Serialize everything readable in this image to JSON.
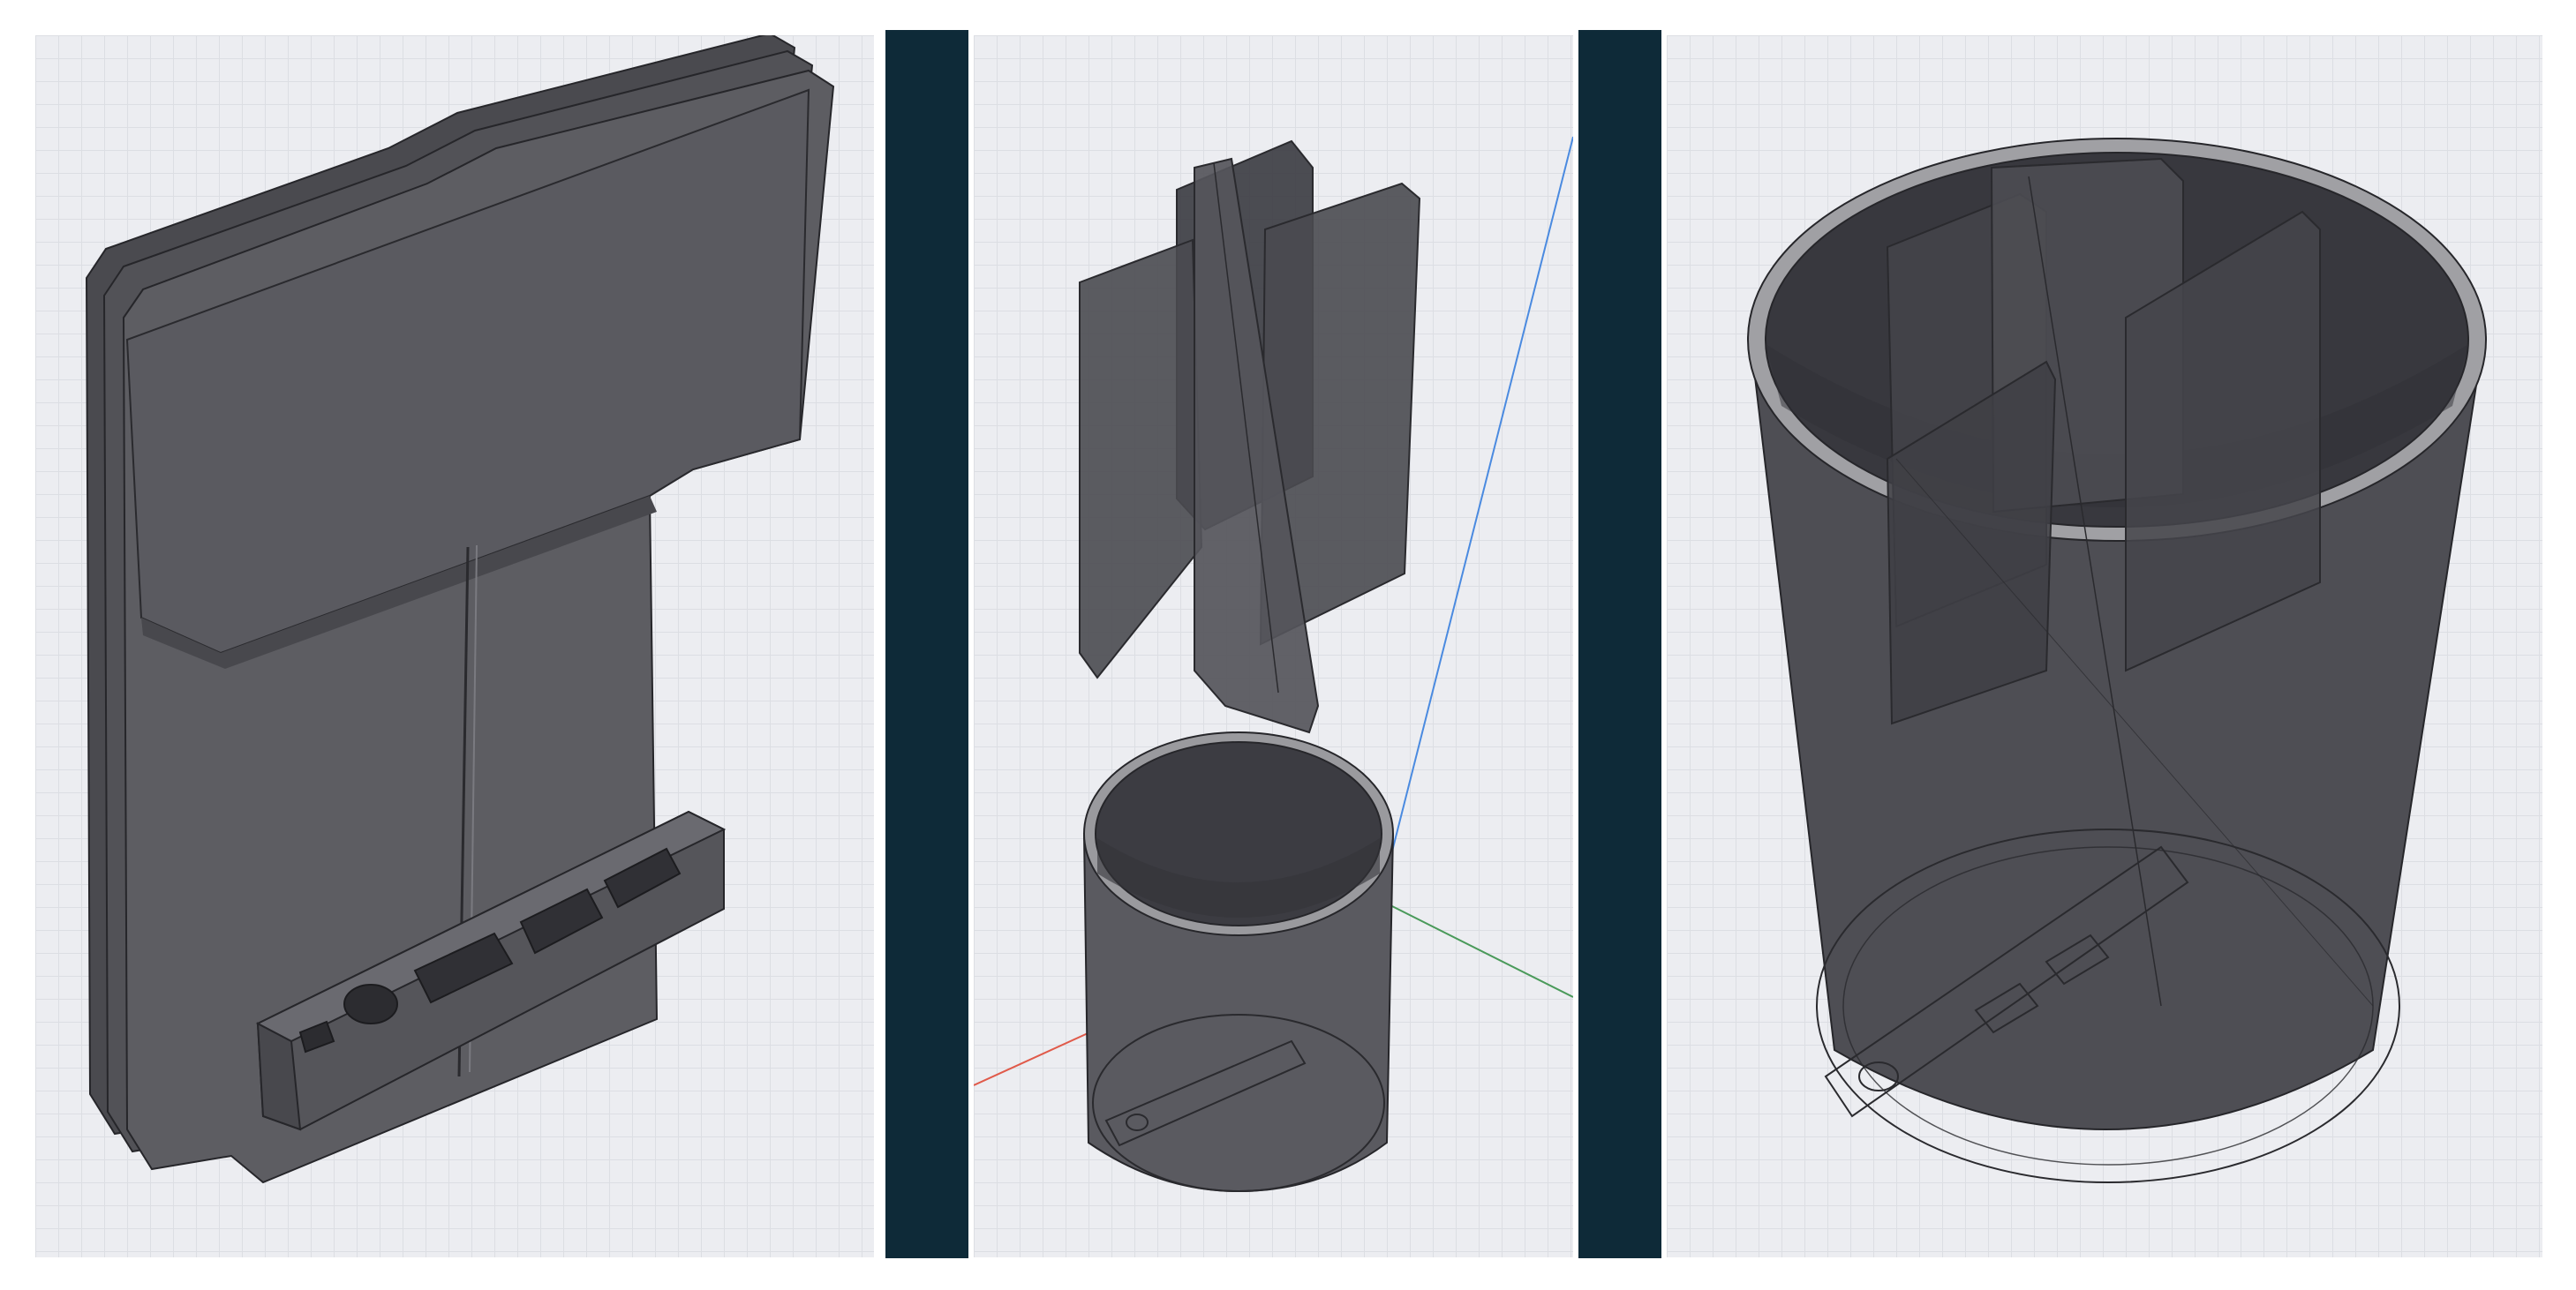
{
  "views": [
    {
      "id": "view-flat-parts",
      "description_icon": "flat-parts-model"
    },
    {
      "id": "view-exploded-assembly",
      "description_icon": "exploded-assembly-model"
    },
    {
      "id": "view-assembled-cup",
      "description_icon": "assembled-cup-model"
    }
  ],
  "colors": {
    "viewport_bg": "#ecedf1",
    "grid_line": "#dcdee3",
    "divider": "#0e2a38",
    "part_face": "#5d5d62",
    "part_dark": "#3a3a3f",
    "part_edge": "#2a2a2e",
    "rim": "#9a9a9e",
    "axis_x": "#e05a4a",
    "axis_y": "#4a9a5a",
    "axis_z": "#4a8ae0"
  }
}
